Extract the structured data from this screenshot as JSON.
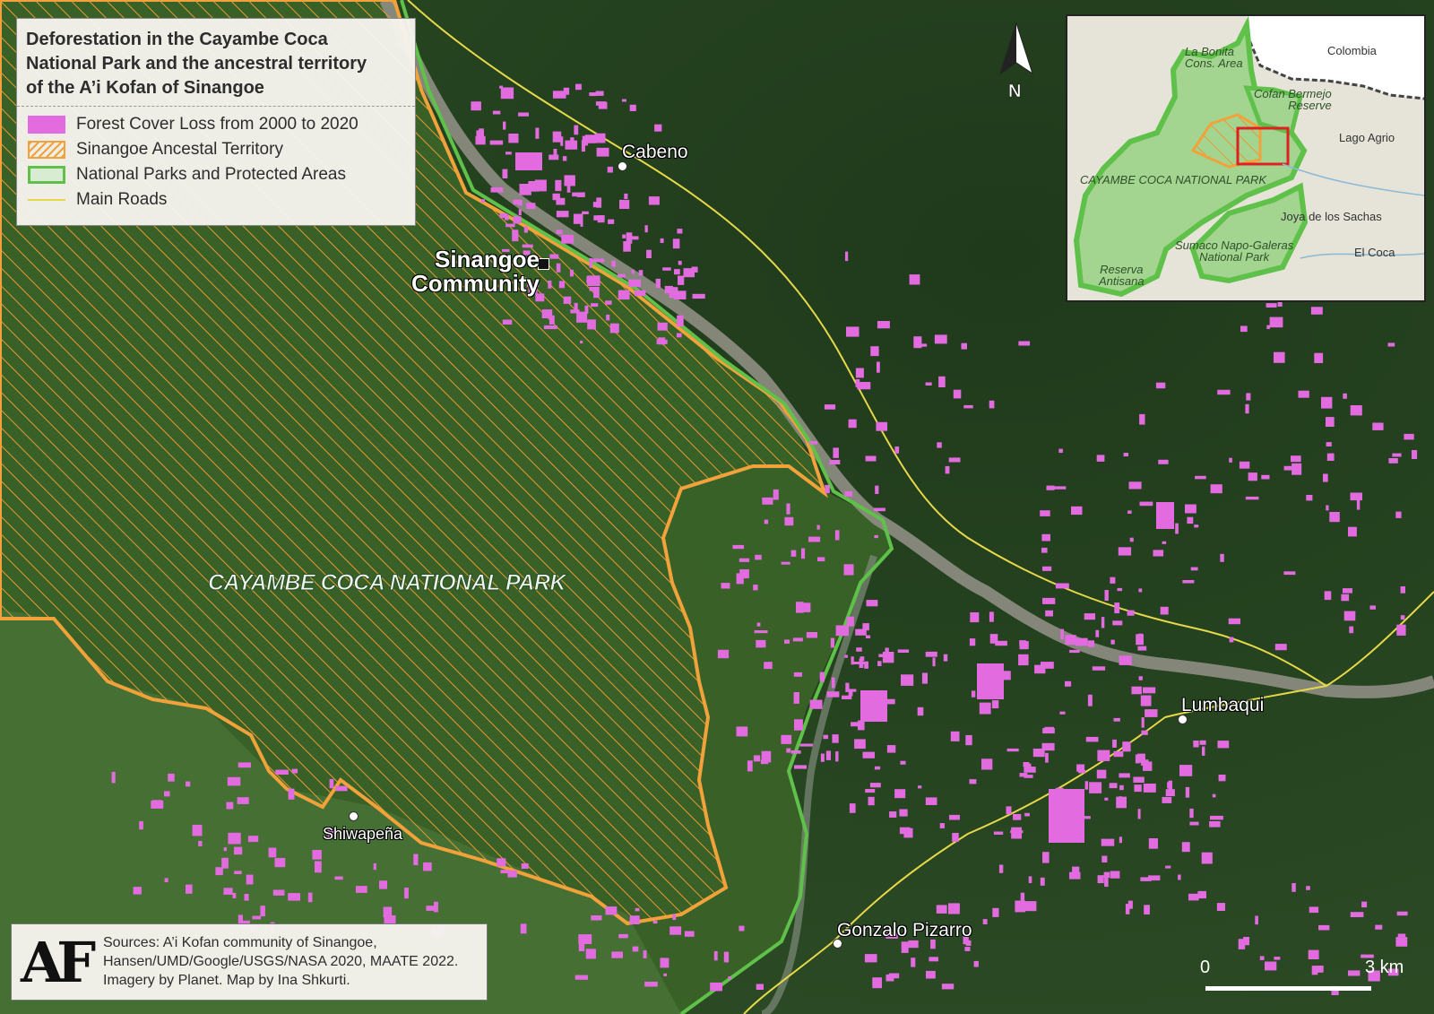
{
  "legend": {
    "title_line1": "Deforestation in the Cayambe Coca",
    "title_line2": "National Park and the ancestral territory",
    "title_line3": "of the A’i Kofan of Sinangoe",
    "items": [
      {
        "label": "Forest Cover Loss from 2000 to 2020",
        "color": "#e26be0"
      },
      {
        "label": "Sinangoe Ancestal Territory",
        "color": "#f2a23a"
      },
      {
        "label": "National Parks and Protected Areas",
        "color": "#5fc14a"
      },
      {
        "label": "Main Roads",
        "color": "#e6d84a"
      }
    ]
  },
  "places": {
    "cabeno": "Cabeno",
    "sinangoe_line1": "Sinangoe",
    "sinangoe_line2": "Community",
    "park": "CAYAMBE COCA NATIONAL PARK",
    "shiwapena": "Shiwapeña",
    "lumbaqui": "Lumbaqui",
    "gonzalo": "Gonzalo Pizarro"
  },
  "north": "N",
  "inset": {
    "colombia": "Colombia",
    "la_bonita_line1": "La Bonita",
    "la_bonita_line2": "Cons. Area",
    "cofan_line1": "Cofan Bermejo",
    "cofan_line2": "Reserve",
    "lago_agrio": "Lago Agrio",
    "cayambe": "CAYAMBE COCA NATIONAL PARK",
    "joya": "Joya de los Sachas",
    "sumaco_line1": "Sumaco Napo-Galeras",
    "sumaco_line2": "National Park",
    "el_coca": "El Coca",
    "reserva_line1": "Reserva",
    "reserva_line2": "Antisana"
  },
  "sources": {
    "logo": "AF",
    "text": "Sources: A’i Kofan community of Sinangoe,\nHansen/UMD/Google/USGS/NASA 2020, MAATE 2022.\nImagery by Planet. Map by Ina Shkurti."
  },
  "scale": {
    "start": "0",
    "end": "3 km"
  },
  "colors": {
    "forest": "#27441f",
    "park_fill": "#3d6a2b",
    "river": "#8e8f86",
    "loss": "#e26be0",
    "territory": "#f2a23a",
    "park_border": "#5fc14a",
    "road": "#e6d84a",
    "inset_box": "#e02020"
  }
}
